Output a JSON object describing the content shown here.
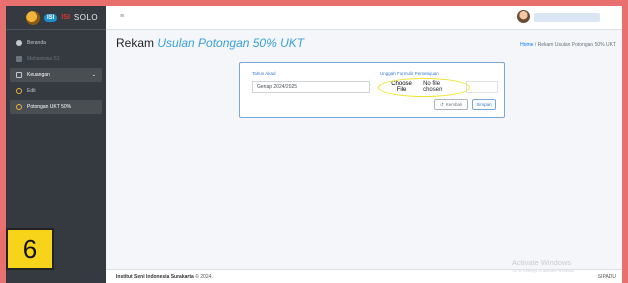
{
  "brand": {
    "badge": "ISI",
    "name_red": "ISI",
    "name": "SOLO"
  },
  "sidebar": {
    "items": [
      {
        "label": "Beranda"
      },
      {
        "label": "Mahasiswa S1"
      },
      {
        "label": "Keuangan"
      },
      {
        "label": "Edit"
      },
      {
        "label": "Potongan UKT 50%"
      }
    ]
  },
  "header": {
    "title_plain": "Rekam",
    "title_accent": "Usulan Potongan 50% UKT"
  },
  "breadcrumb": {
    "home": "Home",
    "separator": "/",
    "current": "Rekam Usulan Potongan 50% UKT"
  },
  "form": {
    "tahun_label": "Tahun Akad",
    "tahun_value": "Genap 2024/2025",
    "upload_label": "Unggah Formulir Persetujuan",
    "choose_file": "Choose File",
    "no_file": "No file chosen",
    "kembali": "Kembali",
    "simpan": "Simpan"
  },
  "footer": {
    "institution": "Institut Seni Indonesia Surakarta",
    "copyright": "© 2024.",
    "app": "SIPADU"
  },
  "watermark": {
    "title": "Activate Windows",
    "subtitle": "Go to Settings to activate Windows."
  },
  "overlay": {
    "number": "6"
  },
  "colors": {
    "accent": "#3aa0d9",
    "highlight": "#f0e22b",
    "overlay": "#f7d31a"
  }
}
